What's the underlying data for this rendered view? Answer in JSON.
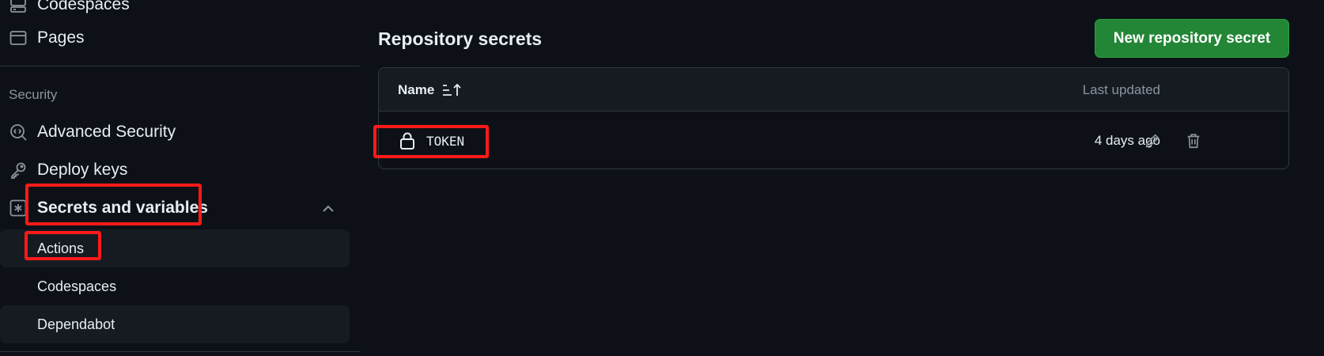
{
  "sidebar": {
    "codespaces_top": "Codespaces",
    "pages": "Pages",
    "section_security": "Security",
    "advanced_security": "Advanced Security",
    "deploy_keys": "Deploy keys",
    "secrets_and_variables": "Secrets and variables",
    "sub_items": [
      "Actions",
      "Codespaces",
      "Dependabot"
    ]
  },
  "main": {
    "title": "Repository secrets",
    "new_button": "New repository secret",
    "table": {
      "col_name": "Name",
      "col_updated": "Last updated",
      "rows": [
        {
          "name": "TOKEN",
          "updated": "4 days ago"
        }
      ]
    }
  },
  "colors": {
    "background": "#0d1117",
    "accent_green": "#238636",
    "annotation_red": "#ff1a1a"
  }
}
